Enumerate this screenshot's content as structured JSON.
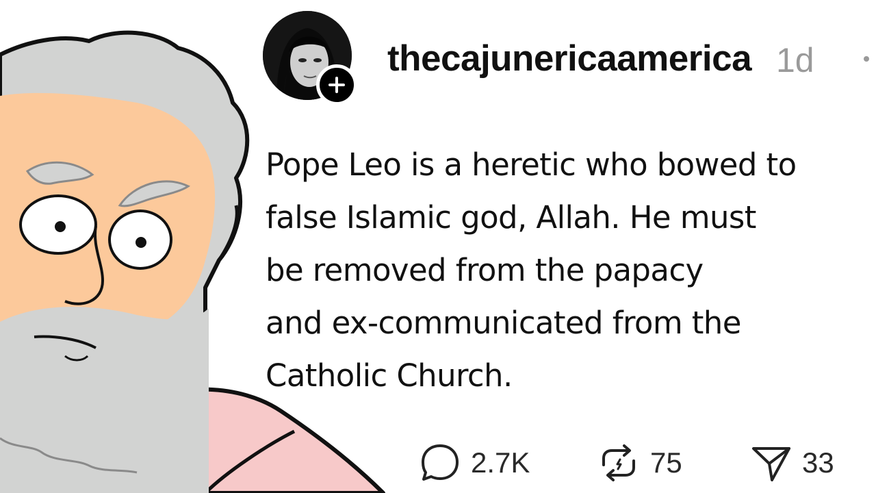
{
  "post": {
    "username": "thecajunericaamerica",
    "timestamp": "1d",
    "text_lines": [
      "Pope Leo is a heretic who bowed to",
      "false Islamic god, Allah. He must",
      "be removed from the papacy",
      "and ex-communicated from the",
      "Catholic Church."
    ]
  },
  "actions": {
    "replies": "2.7K",
    "reposts": "75",
    "shares": "33"
  },
  "icons": {
    "avatar": "profile-photo",
    "follow": "plus-icon",
    "more": "more-dots-icon",
    "reply": "speech-bubble-icon",
    "repost": "repost-arrows-icon",
    "share": "paper-plane-icon"
  },
  "colors": {
    "text": "#111111",
    "timestamp": "#9a9a9a",
    "skin": "#fcc99b",
    "hair": "#d2d3d2",
    "robe": "#f7c9c9"
  }
}
